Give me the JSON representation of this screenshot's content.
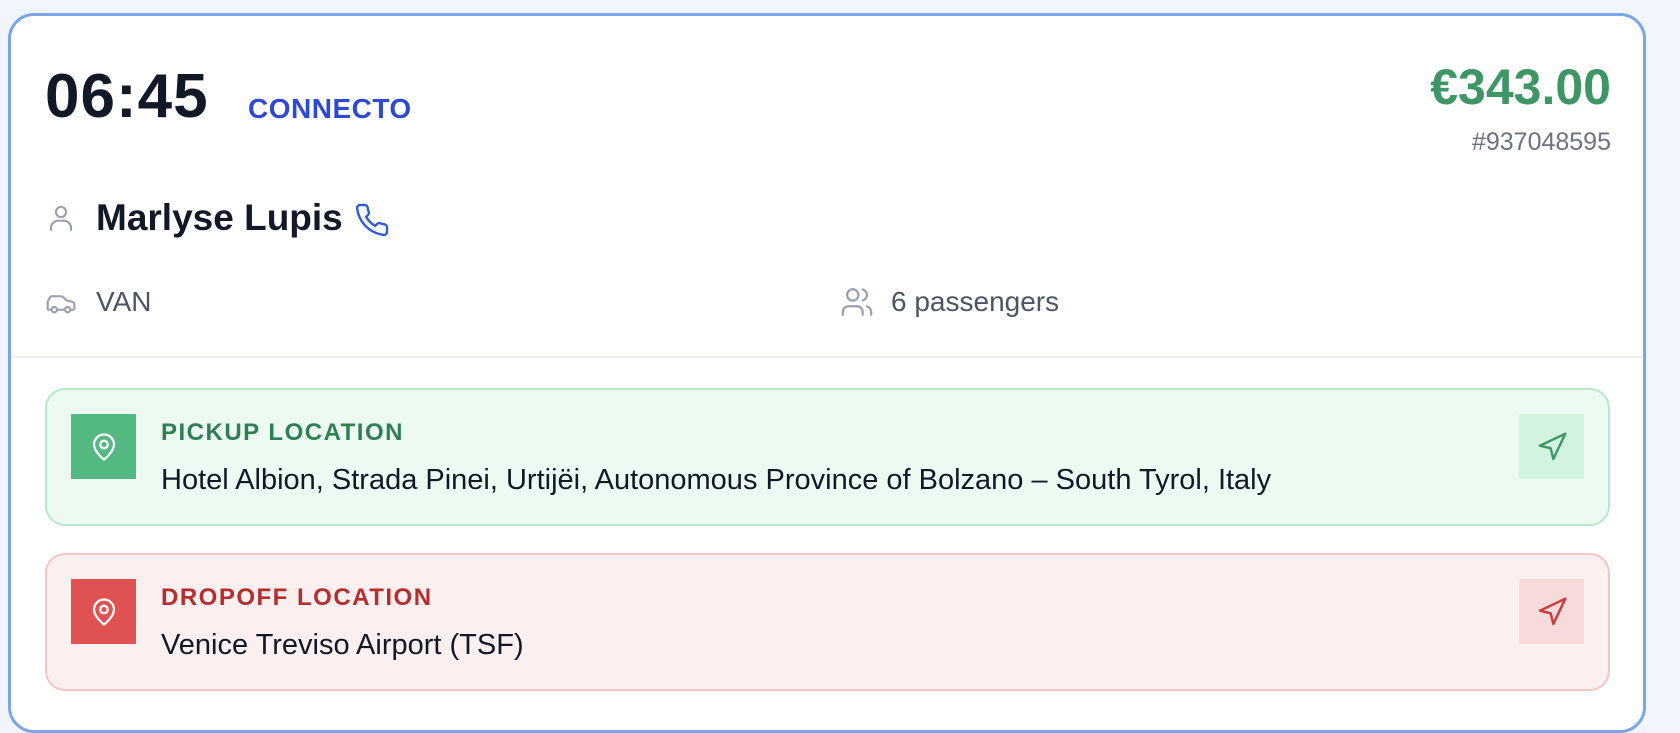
{
  "booking": {
    "time": "06:45",
    "company": "CONNECTO",
    "price": "€343.00",
    "id": "#937048595"
  },
  "customer": {
    "name": "Marlyse Lupis"
  },
  "details": {
    "vehicle": "VAN",
    "passengers": "6 passengers"
  },
  "pickup": {
    "label": "PICKUP LOCATION",
    "address": "Hotel Albion, Strada Pinei, Urtijëi, Autonomous Province of Bolzano – South Tyrol, Italy"
  },
  "dropoff": {
    "label": "DROPOFF LOCATION",
    "address": "Venice Treviso Airport (TSF)"
  },
  "icons": {
    "person": "person-icon",
    "phone": "phone-icon",
    "car": "car-icon",
    "users": "users-icon",
    "pin": "map-pin-icon",
    "navigate": "navigation-arrow-icon"
  },
  "colors": {
    "card_border": "#7ba4ea",
    "company": "#2e49d3",
    "price": "#3e9566",
    "pickup_accent": "#54b883",
    "dropoff_accent": "#e05252"
  }
}
